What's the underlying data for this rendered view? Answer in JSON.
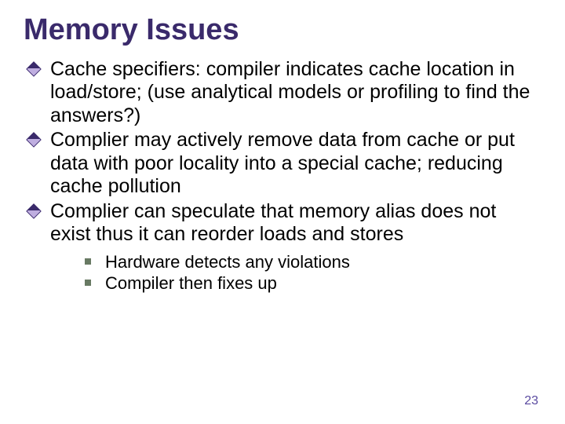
{
  "title": "Memory Issues",
  "bullets": [
    "Cache specifiers: compiler indicates cache location in load/store; (use analytical models or profiling to find the answers?)",
    "Complier may actively remove data from cache or put data with poor locality into a special cache; reducing cache pollution",
    "Complier can speculate that memory alias does not exist thus it can reorder loads and stores"
  ],
  "subbullets": [
    "Hardware detects any violations",
    "Compiler then fixes up"
  ],
  "page_number": "23"
}
